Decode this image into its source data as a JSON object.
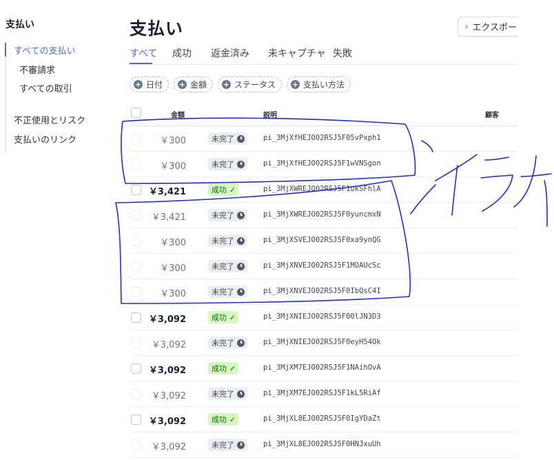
{
  "sidebar": {
    "title": "支払い",
    "items": [
      {
        "label": "すべての支払い",
        "active": true
      },
      {
        "label": "不審請求"
      },
      {
        "label": "すべての取引"
      },
      {
        "label": "不正使用とリスク"
      },
      {
        "label": "支払いのリンク"
      }
    ]
  },
  "header": {
    "title": "支払い",
    "export_label": "エクスポート"
  },
  "tabs": [
    {
      "label": "すべて",
      "active": true
    },
    {
      "label": "成功"
    },
    {
      "label": "返金済み"
    },
    {
      "label": "未キャプチャ"
    },
    {
      "label": "失敗"
    }
  ],
  "filters": [
    {
      "label": "日付"
    },
    {
      "label": "金額"
    },
    {
      "label": "ステータス"
    },
    {
      "label": "支払い方法"
    }
  ],
  "table": {
    "columns": {
      "amount": "金額",
      "description": "説明",
      "customer": "顧客"
    },
    "rows": [
      {
        "amount": "￥300",
        "status": "未完了",
        "status_type": "pending",
        "description": "pi_3MjXfHEJO02RSJ5F05vPxph1"
      },
      {
        "amount": "￥300",
        "status": "未完了",
        "status_type": "pending",
        "description": "pi_3MjXfHEJO02RSJ5F1wVNSgon"
      },
      {
        "amount": "￥3,421",
        "status": "成功",
        "status_type": "success",
        "description": "pi_3MjXWREJO02RSJ5F1ukSFhlA"
      },
      {
        "amount": "￥3,421",
        "status": "未完了",
        "status_type": "pending",
        "description": "pi_3MjXWREJO02RSJ5F0yuncmxN"
      },
      {
        "amount": "￥300",
        "status": "未完了",
        "status_type": "pending",
        "description": "pi_3MjXSVEJO02RSJ5F0xa9ynQG"
      },
      {
        "amount": "￥300",
        "status": "未完了",
        "status_type": "pending",
        "description": "pi_3MjXNVEJO02RSJ5F1MOAUcSc"
      },
      {
        "amount": "￥300",
        "status": "未完了",
        "status_type": "pending",
        "description": "pi_3MjXNVEJO02RSJ5F0IbQsC4I"
      },
      {
        "amount": "￥3,092",
        "status": "成功",
        "status_type": "success",
        "description": "pi_3MjXNIEJO02RSJ5F00lJN3D3"
      },
      {
        "amount": "￥3,092",
        "status": "未完了",
        "status_type": "pending",
        "description": "pi_3MjXNIEJO02RSJ5F0eyH54Ok"
      },
      {
        "amount": "￥3,092",
        "status": "成功",
        "status_type": "success",
        "description": "pi_3MjXM7EJO02RSJ5F1NAihOvA"
      },
      {
        "amount": "￥3,092",
        "status": "未完了",
        "status_type": "pending",
        "description": "pi_3MjXM7EJO02RSJ5F1kL5RiAf"
      },
      {
        "amount": "￥3,092",
        "status": "成功",
        "status_type": "success",
        "description": "pi_3MjXL8EJO02RSJ5F0IgYDaZt"
      },
      {
        "amount": "￥3,092",
        "status": "未完了",
        "status_type": "pending",
        "description": "pi_3MjXL8EJO02RSJ5F0HNJxuUh"
      }
    ]
  },
  "annotation": {
    "handwritten_text": "イラナイ",
    "ink_color": "#1c2fc7"
  }
}
